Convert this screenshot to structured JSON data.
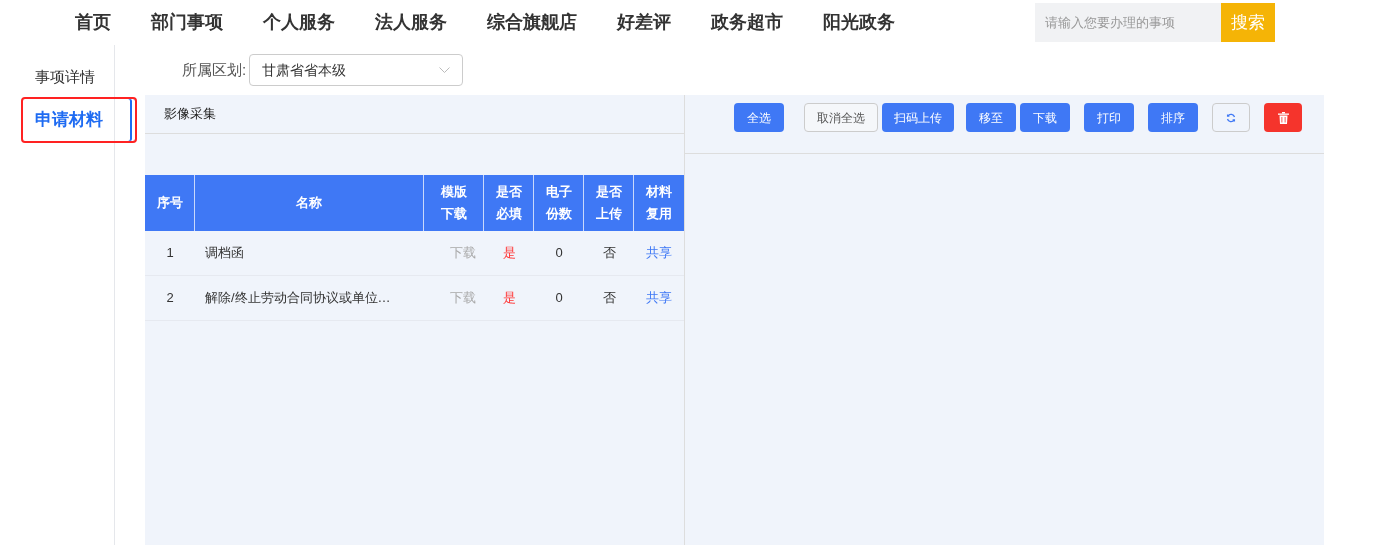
{
  "nav": {
    "items": [
      "首页",
      "部门事项",
      "个人服务",
      "法人服务",
      "综合旗舰店",
      "好差评",
      "政务超市",
      "阳光政务"
    ],
    "search": {
      "placeholder": "请输入您要办理的事项",
      "button": "搜索"
    }
  },
  "sidebar": {
    "items": [
      {
        "label": "事项详情",
        "selected": false
      },
      {
        "label": "申请材料",
        "selected": true
      }
    ]
  },
  "region": {
    "label": "所属区划:",
    "value": "甘肃省省本级"
  },
  "tabs": [
    {
      "label": "影像采集",
      "selected": true
    }
  ],
  "toolbar": [
    {
      "kind": "primary",
      "label": "全选"
    },
    {
      "kind": "plain",
      "label": "取消全选"
    },
    {
      "kind": "primary",
      "label": "扫码上传"
    },
    {
      "kind": "primary",
      "label": "移至"
    },
    {
      "kind": "primary",
      "label": "下载"
    },
    {
      "kind": "primary",
      "label": "打印"
    },
    {
      "kind": "primary",
      "label": "排序"
    },
    {
      "kind": "refresh"
    },
    {
      "kind": "delete"
    }
  ],
  "table": {
    "columns": [
      "序号",
      "名称",
      "模版下载",
      "是否必填",
      "电子份数",
      "是否上传",
      "材料复用"
    ],
    "rows": [
      {
        "index": "1",
        "name": "调档函",
        "template": "下载",
        "template_disabled": true,
        "required": "是",
        "copies": "0",
        "uploaded": "否",
        "reuse": "共享"
      },
      {
        "index": "2",
        "name": "解除/终止劳动合同协议或单位…",
        "template": "下载",
        "template_disabled": true,
        "required": "是",
        "copies": "0",
        "uploaded": "否",
        "reuse": "共享"
      }
    ]
  }
}
